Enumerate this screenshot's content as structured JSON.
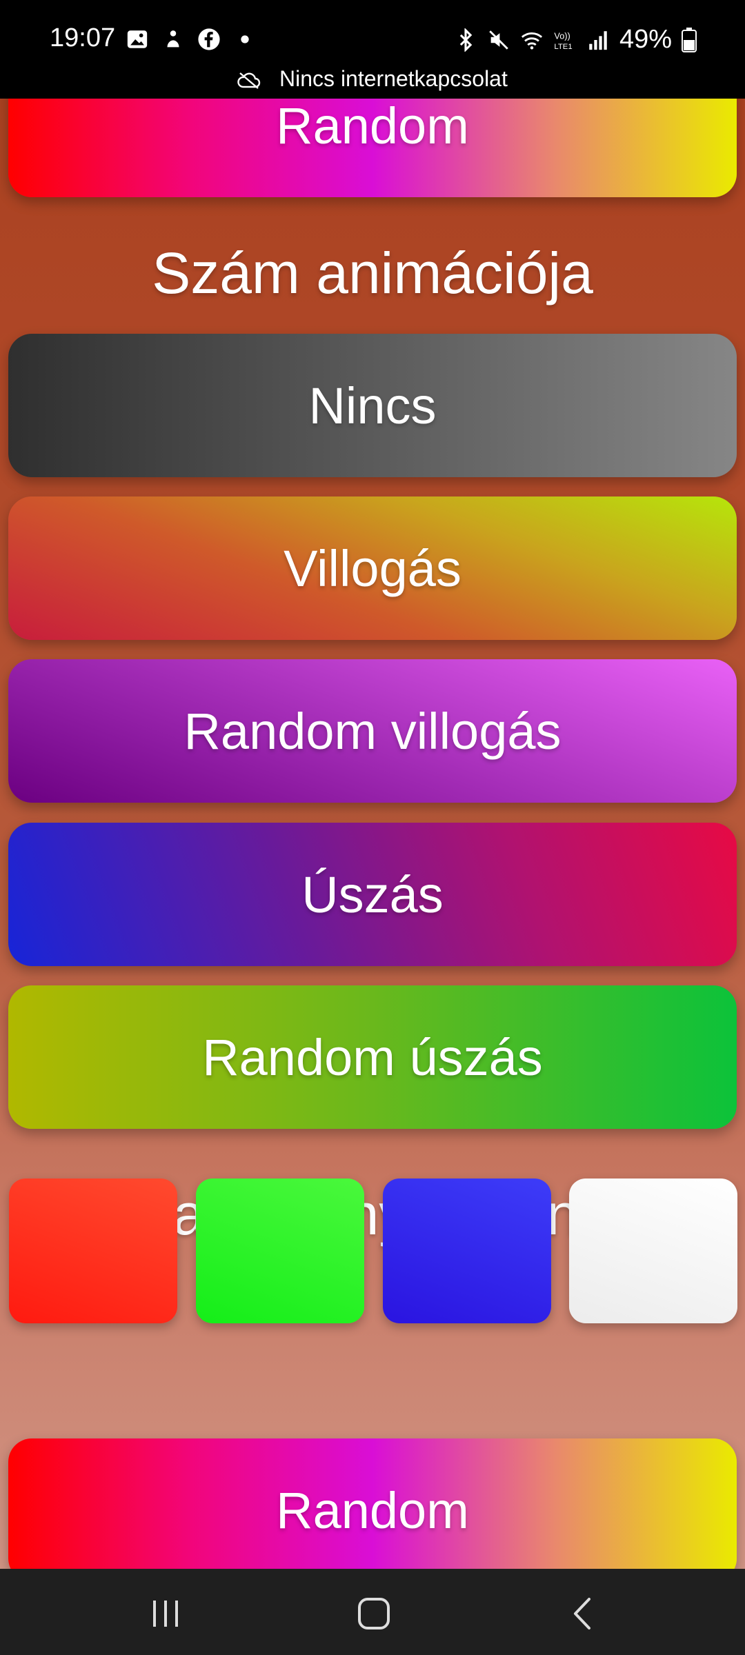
{
  "status_bar": {
    "time": "19:07",
    "notification_icons": [
      "gallery-icon",
      "messenger-icon",
      "facebook-icon",
      "dot-icon"
    ],
    "system_icons": [
      "bluetooth-icon",
      "mute-icon",
      "wifi-icon",
      "volte-icon",
      "signal-icon"
    ],
    "battery": "49%",
    "network_message": "Nincs internetkapcsolat"
  },
  "buttons": {
    "random_top": "Random",
    "none": "Nincs",
    "blink": "Villogás",
    "random_blink": "Random villogás",
    "swim": "Úszás",
    "random_swim": "Random úszás",
    "random_bottom": "Random"
  },
  "sections": {
    "number_animation": "Szám animációja",
    "tree_color": "Karácsonyfa színe"
  },
  "colors": {
    "swatches": [
      "#ff2a1a",
      "#22f02a",
      "#2d22ee",
      "#f6f6f6"
    ],
    "background": "#ab4221"
  },
  "nav": [
    "recents-icon",
    "home-icon",
    "back-icon"
  ]
}
